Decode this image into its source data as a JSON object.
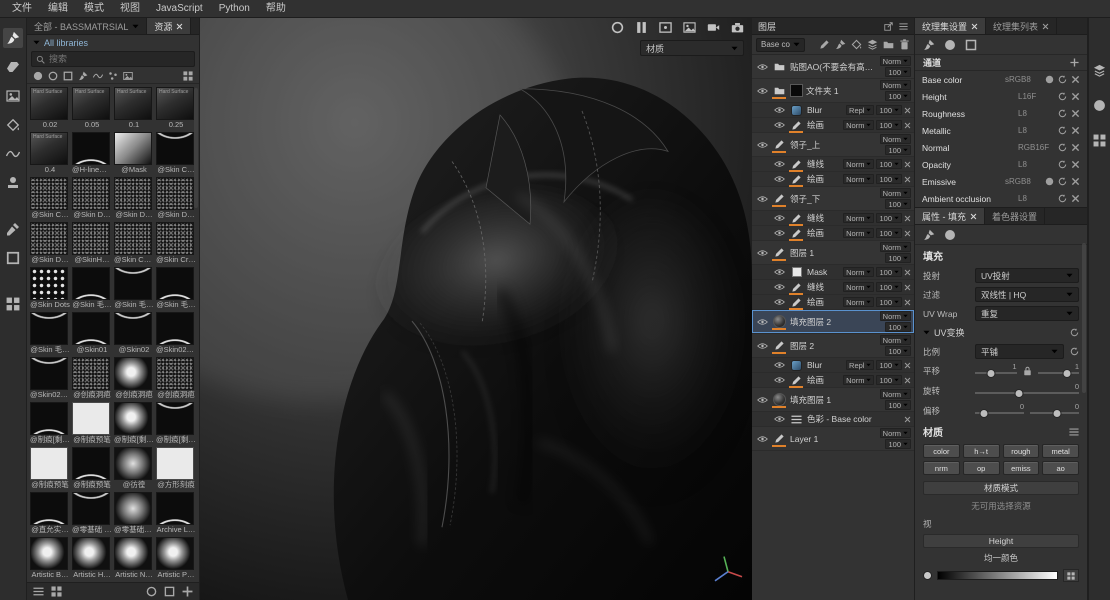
{
  "colors": {
    "accent": "#4a90d2",
    "orange": "#e0812a",
    "selection": "#5a92cf"
  },
  "menubar": {
    "items": [
      "文件",
      "编辑",
      "模式",
      "视图",
      "JavaScript",
      "Python",
      "帮助"
    ]
  },
  "toolstrip": {
    "tools": [
      {
        "name": "paint-tool-icon",
        "icon": "#i-brush",
        "act": true
      },
      {
        "name": "eraser-tool-icon",
        "icon": "#i-eraser"
      },
      {
        "name": "projection-tool-icon",
        "icon": "#i-image"
      },
      {
        "name": "polygon-fill-tool-icon",
        "icon": "#i-bucket"
      },
      {
        "name": "smudge-tool-icon",
        "icon": "#i-wave"
      },
      {
        "name": "clone-tool-icon",
        "icon": "#i-stamp"
      },
      {
        "name": "tool-spacer",
        "spacer": true
      },
      {
        "name": "material-picker-tool-icon",
        "icon": "#i-dropper"
      },
      {
        "name": "quick-mask-tool-icon",
        "icon": "#i-square"
      },
      {
        "name": "tool-spacer-2",
        "spacer": true
      },
      {
        "name": "symmetry-tool-icon",
        "icon": "#i-grid"
      }
    ]
  },
  "assets": {
    "tab_browser": "全部 - BASSMATRSIAL",
    "tab_assets": "资源",
    "library": "All libraries",
    "search_placeholder": "搜索",
    "filter_icons": [
      {
        "name": "filter-materials-icon",
        "icon": "#i-sphere"
      },
      {
        "name": "filter-smart-materials-icon",
        "icon": "#i-circle"
      },
      {
        "name": "filter-smart-masks-icon",
        "icon": "#i-square"
      },
      {
        "name": "filter-brushes-icon",
        "icon": "#i-brush"
      },
      {
        "name": "filter-alphas-icon",
        "icon": "#i-wave"
      },
      {
        "name": "filter-patterns-icon",
        "icon": "#i-dots"
      },
      {
        "name": "filter-environments-icon",
        "icon": "#i-image"
      }
    ],
    "items": [
      {
        "label": "0.02",
        "kind": "hs",
        "sub": "Hard Surface"
      },
      {
        "label": "0.05",
        "kind": "hs",
        "sub": "Hard Surface"
      },
      {
        "label": "0.1",
        "kind": "hs",
        "sub": "Hard Surface"
      },
      {
        "label": "0.25",
        "kind": "hs",
        "sub": "Hard Surface"
      },
      {
        "label": "0.4",
        "kind": "hs",
        "sub": "Hard Surface"
      },
      {
        "label": "@H-line缝…",
        "kind": "wave"
      },
      {
        "label": "@Mask",
        "kind": "mask"
      },
      {
        "label": "@Skin C…",
        "kind": "wave2"
      },
      {
        "label": "@Skin C…",
        "kind": "noise"
      },
      {
        "label": "@Skin D…",
        "kind": "noise"
      },
      {
        "label": "@Skin D…",
        "kind": "noise"
      },
      {
        "label": "@Skin D…",
        "kind": "noise"
      },
      {
        "label": "@Skin D…",
        "kind": "noise"
      },
      {
        "label": "@SkinH…",
        "kind": "noise"
      },
      {
        "label": "@Skin Co…",
        "kind": "noise"
      },
      {
        "label": "@Skin Cr…",
        "kind": "noise"
      },
      {
        "label": "@Skin Dots",
        "kind": "dots"
      },
      {
        "label": "@Skin 毛…",
        "kind": "wave"
      },
      {
        "label": "@Skin 毛…",
        "kind": "wave2"
      },
      {
        "label": "@Skin 毛…",
        "kind": "wave"
      },
      {
        "label": "@Skin 毛…",
        "kind": "wave2"
      },
      {
        "label": "@Skin01",
        "kind": "wave"
      },
      {
        "label": "@Skin02",
        "kind": "wave2"
      },
      {
        "label": "@Skin02 …",
        "kind": "wave"
      },
      {
        "label": "@Skin02 毛…",
        "kind": "wave2"
      },
      {
        "label": "@创痕洞疤",
        "kind": "noise"
      },
      {
        "label": "@创痕洞疤",
        "kind": "splat"
      },
      {
        "label": "@创痕洞疤",
        "kind": "noise"
      },
      {
        "label": "@制痕[剩]…",
        "kind": "wave"
      },
      {
        "label": "@制痕预笔",
        "kind": "square"
      },
      {
        "label": "@制痕[剩]…",
        "kind": "splat"
      },
      {
        "label": "@制痕[剩]…",
        "kind": "wave2"
      },
      {
        "label": "@制痕预笔",
        "kind": "square"
      },
      {
        "label": "@制痕预笔",
        "kind": "wave"
      },
      {
        "label": "@彷徨",
        "kind": "blob"
      },
      {
        "label": "@方形刻痕",
        "kind": "square"
      },
      {
        "label": "@直允实…",
        "kind": "wave"
      },
      {
        "label": "@零基础 兰…",
        "kind": "wave2"
      },
      {
        "label": "@零基础总…",
        "kind": "blob"
      },
      {
        "label": "Archive L…",
        "kind": "wave"
      },
      {
        "label": "Artistic B…",
        "kind": "splat"
      },
      {
        "label": "Artistic H…",
        "kind": "splat"
      },
      {
        "label": "Artistic N…",
        "kind": "splat"
      },
      {
        "label": "Artistic P…",
        "kind": "splat"
      }
    ],
    "footer_left": [
      {
        "name": "list-view-icon",
        "icon": "#i-burger"
      },
      {
        "name": "grid-view-icon",
        "icon": "#i-grid"
      }
    ],
    "footer_right": [
      {
        "name": "sphere-preview-icon",
        "icon": "#i-circle"
      },
      {
        "name": "flat-preview-icon",
        "icon": "#i-square"
      },
      {
        "name": "add-asset-icon",
        "icon": "#i-plus"
      }
    ]
  },
  "viewport": {
    "material_selector": "材质",
    "toolbar_icons": [
      {
        "name": "wireframe-toggle-icon",
        "icon": "#i-circle"
      },
      {
        "name": "pause-engine-icon",
        "icon": "#i-pause"
      },
      {
        "name": "frame-view-icon",
        "icon": "#i-frame"
      },
      {
        "name": "display-settings-icon",
        "icon": "#i-image"
      },
      {
        "name": "video-capture-icon",
        "icon": "#i-video"
      },
      {
        "name": "screenshot-icon",
        "icon": "#i-camera"
      }
    ]
  },
  "layers": {
    "title": "图层",
    "channel_selector": "Base co",
    "toolbar_icons": [
      {
        "name": "add-effect-icon",
        "icon": "#i-pencil"
      },
      {
        "name": "add-paint-layer-icon",
        "icon": "#i-brush"
      },
      {
        "name": "add-fill-layer-icon",
        "icon": "#i-bucket"
      },
      {
        "name": "add-smart-material-icon",
        "icon": "#i-layers"
      },
      {
        "name": "add-folder-icon",
        "icon": "#i-folder"
      },
      {
        "name": "delete-layer-icon",
        "icon": "#i-trash"
      }
    ],
    "rows": [
      {
        "name": "贴图AO(不要会有高度…",
        "type": "folder",
        "tall": true,
        "blend": "Norm",
        "opacity": "100",
        "indent": 0
      },
      {
        "name": "文件夹 1",
        "type": "folder",
        "tall": true,
        "thumb": true,
        "blend": "Norm",
        "opacity": "100",
        "indent": 0,
        "orange": true
      },
      {
        "name": "Blur",
        "type": "filter",
        "blend": "Repl",
        "opacity": "100",
        "indent": 1,
        "x": true
      },
      {
        "name": "绘画",
        "type": "paintfx",
        "blend": "Norm",
        "opacity": "100",
        "indent": 1,
        "x": true,
        "orange": true
      },
      {
        "name": "领子_上",
        "type": "paint",
        "tall": true,
        "blend": "Norm",
        "opacity": "100",
        "indent": 0,
        "orange": true
      },
      {
        "name": "缝线",
        "type": "paintfx",
        "blend": "Norm",
        "opacity": "100",
        "indent": 1,
        "x": true,
        "orange": true
      },
      {
        "name": "绘画",
        "type": "paintfx",
        "blend": "Norm",
        "opacity": "100",
        "indent": 1,
        "x": true,
        "orange": true
      },
      {
        "name": "领子_下",
        "type": "paint",
        "tall": true,
        "blend": "Norm",
        "opacity": "100",
        "indent": 0,
        "orange": true
      },
      {
        "name": "缝线",
        "type": "paintfx",
        "blend": "Norm",
        "opacity": "100",
        "indent": 1,
        "x": true,
        "orange": true
      },
      {
        "name": "绘画",
        "type": "paintfx",
        "blend": "Norm",
        "opacity": "100",
        "indent": 1,
        "x": true,
        "orange": true
      },
      {
        "name": "图层 1",
        "type": "paint",
        "tall": true,
        "blend": "Norm",
        "opacity": "100",
        "indent": 0,
        "orange": true
      },
      {
        "name": "Mask",
        "type": "mask",
        "blend": "Norm",
        "opacity": "100",
        "indent": 1,
        "x": true
      },
      {
        "name": "缝线",
        "type": "paintfx",
        "blend": "Norm",
        "opacity": "100",
        "indent": 1,
        "x": true,
        "orange": true
      },
      {
        "name": "绘画",
        "type": "paintfx",
        "blend": "Norm",
        "opacity": "100",
        "indent": 1,
        "x": true,
        "orange": true
      },
      {
        "name": "填充图层 2",
        "type": "fill",
        "tall": true,
        "blend": "Norm",
        "opacity": "100",
        "indent": 0,
        "selected": true,
        "orange": true
      },
      {
        "name": "图层 2",
        "type": "paint",
        "tall": true,
        "blend": "Norm",
        "opacity": "100",
        "indent": 0,
        "orange": true
      },
      {
        "name": "Blur",
        "type": "filter",
        "blend": "Repl",
        "opacity": "100",
        "indent": 1,
        "x": true
      },
      {
        "name": "绘画",
        "type": "paintfx",
        "blend": "Norm",
        "opacity": "100",
        "indent": 1,
        "x": true,
        "orange": true
      },
      {
        "name": "填充图层 1",
        "type": "fill",
        "tall": true,
        "blend": "Norm",
        "opacity": "100",
        "indent": 0,
        "orange": true
      },
      {
        "name": "色彩 - Base color",
        "type": "color",
        "indent": 1,
        "x": true
      },
      {
        "name": "Layer 1",
        "type": "paint",
        "tall": true,
        "blend": "Norm",
        "opacity": "100",
        "indent": 0,
        "orange": true
      }
    ]
  },
  "textureset": {
    "tab_settings": "纹理集设置",
    "tab_list": "纹理集列表",
    "mode_icons": [
      {
        "name": "paint-mode-icon",
        "icon": "#i-brush"
      },
      {
        "name": "material-mode-icon",
        "icon": "#i-sphere"
      },
      {
        "name": "select-mode-icon",
        "icon": "#i-square"
      }
    ],
    "channels_header": "通道",
    "channels": [
      {
        "name": "Base color",
        "format": "sRGB8",
        "extra": true
      },
      {
        "name": "Height",
        "format": "L16F"
      },
      {
        "name": "Roughness",
        "format": "L8"
      },
      {
        "name": "Metallic",
        "format": "L8"
      },
      {
        "name": "Normal",
        "format": "RGB16F"
      },
      {
        "name": "Opacity",
        "format": "L8"
      },
      {
        "name": "Emissive",
        "format": "sRGB8",
        "extra": true
      },
      {
        "name": "Ambient occlusion",
        "format": "L8"
      }
    ]
  },
  "props": {
    "tab_props": "属性 - 填充",
    "tab_shader": "着色器设置",
    "section_fill": "填充",
    "projection_label": "投射",
    "projection_value": "UV投射",
    "filtering_label": "过滤",
    "filtering_value": "双线性 | HQ",
    "uvwrap_label": "UV Wrap",
    "uvwrap_value": "重复",
    "uvtransform_header": "UV变换",
    "scale_label": "比例",
    "scale_value": "平铺",
    "translate_label": "平移",
    "translate_x": "1",
    "translate_y": "1",
    "rotate_label": "旋转",
    "rotate_value": "0",
    "offset_label": "偏移",
    "offset_x": "0",
    "offset_y": "0",
    "section_material": "材质",
    "channel_buttons": [
      {
        "label": "color"
      },
      {
        "label": "h→t"
      },
      {
        "label": "rough"
      },
      {
        "label": "metal"
      },
      {
        "label": "nrm"
      },
      {
        "label": "op"
      },
      {
        "label": "emiss"
      },
      {
        "label": "ao"
      }
    ],
    "material_mode_header": "材质模式",
    "no_resource_text": "无可用选择资源",
    "misc_label": "视",
    "height_section": "Height",
    "uniform_color_label": "均一颜色"
  },
  "rightstrip": {
    "icons": [
      {
        "name": "shelf-panel-icon",
        "icon": "#i-layers"
      },
      {
        "name": "display-settings-panel-icon",
        "icon": "#i-sphere"
      },
      {
        "name": "texture-sets-panel-icon",
        "icon": "#i-grid"
      }
    ]
  }
}
